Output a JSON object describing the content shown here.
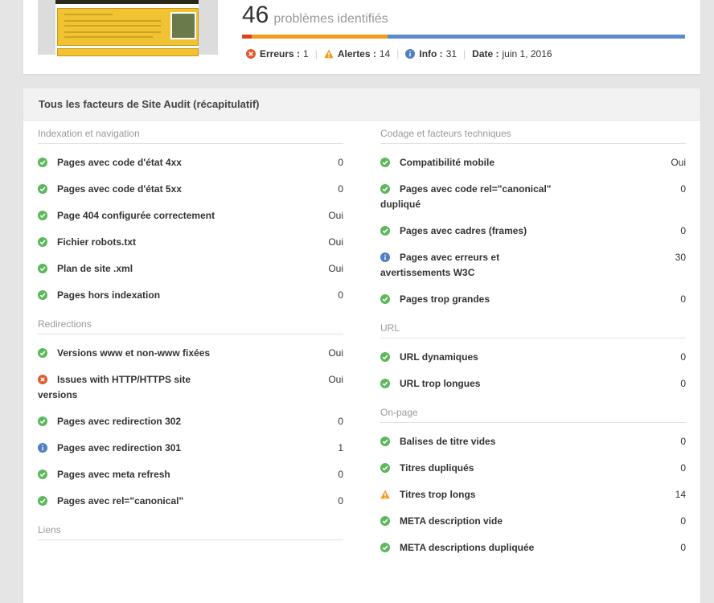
{
  "summary": {
    "count": "46",
    "count_label": "problèmes identifiés",
    "stats": [
      {
        "icon": "error-icon",
        "label": "Erreurs :",
        "value": "1"
      },
      {
        "icon": "warning-icon",
        "label": "Alertes :",
        "value": "14"
      },
      {
        "icon": "info-icon",
        "label": "Info :",
        "value": "31"
      },
      {
        "icon": "",
        "label": "Date :",
        "value": "juin 1, 2016"
      }
    ],
    "colors": {
      "error": "#d9441a",
      "warning": "#f39c20",
      "info": "#5b8ad0",
      "success": "#5cb85c"
    }
  },
  "panel": {
    "title": "Tous les facteurs de Site Audit (récapitulatif)"
  },
  "left_sections": [
    {
      "title": "Indexation et navigation",
      "items": [
        {
          "icon": "check-icon",
          "label": "Pages avec code d'état 4xx",
          "value": "0"
        },
        {
          "icon": "check-icon",
          "label": "Pages avec code d'état 5xx",
          "value": "0"
        },
        {
          "icon": "check-icon",
          "label": "Page 404 configurée correctement",
          "value": "Oui"
        },
        {
          "icon": "check-icon",
          "label": "Fichier robots.txt",
          "value": "Oui"
        },
        {
          "icon": "check-icon",
          "label": "Plan de site .xml",
          "value": "Oui"
        },
        {
          "icon": "check-icon",
          "label": "Pages hors indexation",
          "value": "0"
        }
      ]
    },
    {
      "title": "Redirections",
      "items": [
        {
          "icon": "check-icon",
          "label": "Versions www et non-www fixées",
          "value": "Oui"
        },
        {
          "icon": "error-icon",
          "label": "Issues with HTTP/HTTPS site",
          "label2": "versions",
          "value": "Oui"
        },
        {
          "icon": "check-icon",
          "label": "Pages avec redirection 302",
          "value": "0"
        },
        {
          "icon": "info-icon",
          "label": "Pages avec redirection 301",
          "value": "1"
        },
        {
          "icon": "check-icon",
          "label": "Pages avec meta refresh",
          "value": "0"
        },
        {
          "icon": "check-icon",
          "label": "Pages avec rel=\"canonical\"",
          "value": "0"
        }
      ]
    },
    {
      "title": "Liens",
      "items": []
    }
  ],
  "right_sections": [
    {
      "title": "Codage et facteurs techniques",
      "items": [
        {
          "icon": "check-icon",
          "label": "Compatibilité mobile",
          "value": "Oui"
        },
        {
          "icon": "check-icon",
          "label": "Pages avec code rel=\"canonical\"",
          "label2": "dupliqué",
          "value": "0"
        },
        {
          "icon": "check-icon",
          "label": "Pages avec cadres (frames)",
          "value": "0"
        },
        {
          "icon": "info-icon",
          "label": "Pages avec erreurs et",
          "label2": "avertissements W3C",
          "value": "30"
        },
        {
          "icon": "check-icon",
          "label": "Pages trop grandes",
          "value": "0"
        }
      ]
    },
    {
      "title": "URL",
      "items": [
        {
          "icon": "check-icon",
          "label": "URL dynamiques",
          "value": "0"
        },
        {
          "icon": "check-icon",
          "label": "URL trop longues",
          "value": "0"
        }
      ]
    },
    {
      "title": "On-page",
      "items": [
        {
          "icon": "check-icon",
          "label": "Balises de titre vides",
          "value": "0"
        },
        {
          "icon": "check-icon",
          "label": "Titres dupliqués",
          "value": "0"
        },
        {
          "icon": "warning-icon",
          "label": "Titres trop longs",
          "value": "14"
        },
        {
          "icon": "check-icon",
          "label": "META description vide",
          "value": "0"
        },
        {
          "icon": "check-icon",
          "label": "META descriptions dupliquée",
          "value": "0"
        }
      ]
    }
  ]
}
